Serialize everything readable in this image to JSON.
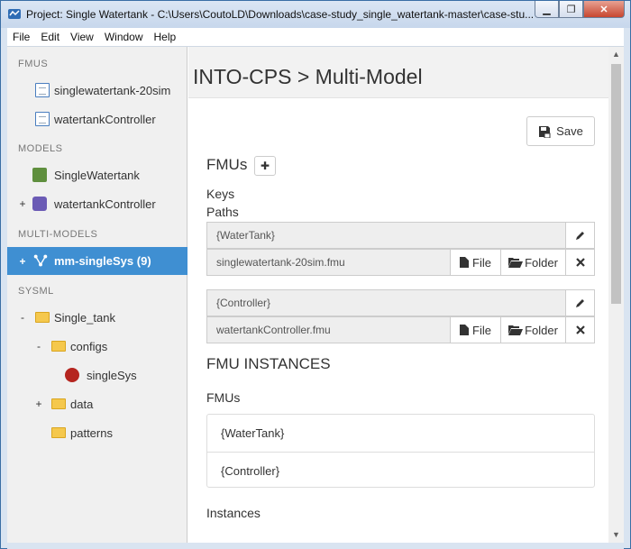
{
  "window": {
    "title": "Project: Single Watertank - C:\\Users\\CoutoLD\\Downloads\\case-study_single_watertank-master\\case-stu...",
    "min_symbol": "▁",
    "max_symbol": "❐",
    "close_symbol": "✕"
  },
  "menu": [
    "File",
    "Edit",
    "View",
    "Window",
    "Help"
  ],
  "sidebar": {
    "fmus_heading": "FMUS",
    "fmus": [
      "singlewatertank-20sim",
      "watertankController"
    ],
    "models_heading": "MODELS",
    "models": [
      {
        "label": "SingleWatertank",
        "expander": ""
      },
      {
        "label": "watertankController",
        "expander": "+"
      }
    ],
    "multimodels_heading": "MULTI-MODELS",
    "multimodel": {
      "label": "mm-singleSys (9)",
      "expander": "+"
    },
    "sysml_heading": "SYSML",
    "sysml": [
      {
        "label": "Single_tank",
        "expander": "-"
      },
      {
        "label": "configs",
        "expander": "-"
      },
      {
        "label": "singleSys",
        "expander": ""
      },
      {
        "label": "data",
        "expander": "+"
      },
      {
        "label": "patterns",
        "expander": ""
      }
    ]
  },
  "main": {
    "title": "INTO-CPS > Multi-Model",
    "save_label": "Save",
    "fmus_heading": "FMUs",
    "add_symbol": "✚",
    "keys_label": "Keys",
    "paths_label": "Paths",
    "fmu_entries": [
      {
        "key": "{WaterTank}",
        "path": "singlewatertank-20sim.fmu"
      },
      {
        "key": "{Controller}",
        "path": "watertankController.fmu"
      }
    ],
    "file_label": "File",
    "folder_label": "Folder",
    "instances_heading": "FMU INSTANCES",
    "instances_fmus_label": "FMUs",
    "instance_fmus": [
      "{WaterTank}",
      "{Controller}"
    ],
    "instances_label": "Instances"
  }
}
